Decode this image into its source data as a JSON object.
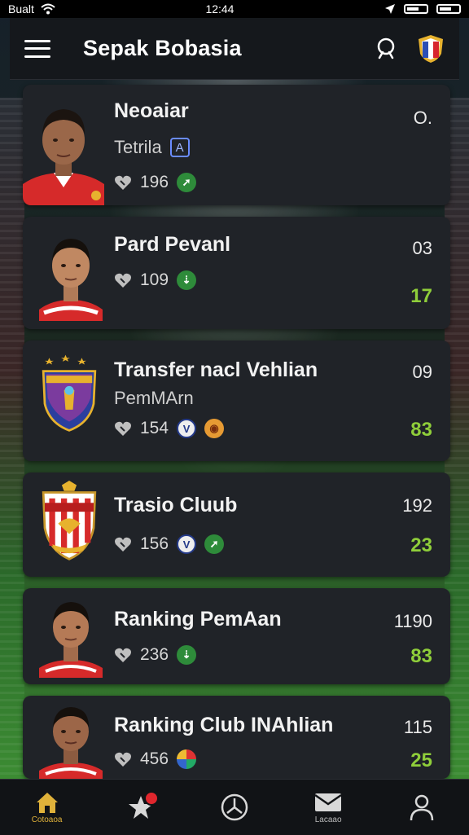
{
  "status": {
    "carrier": "Bualt",
    "time": "12:44"
  },
  "header": {
    "title": "Sepak Bobasia"
  },
  "cards": [
    {
      "title": "Neoaiar",
      "subtitle": "Tetrila",
      "sub_badge": "A",
      "count": "196",
      "right_top": "O.",
      "right_bottom": ""
    },
    {
      "title": "Pard Pevanl",
      "subtitle": "",
      "count": "109",
      "right_top": "03",
      "right_bottom": "17"
    },
    {
      "title": "Transfer nacl Vehlian",
      "subtitle": "PemMArn",
      "count": "154",
      "right_top": "09",
      "right_bottom": "83"
    },
    {
      "title": "Trasio Cluub",
      "subtitle": "",
      "count": "156",
      "right_top": "192",
      "right_bottom": "23"
    },
    {
      "title": "Ranking PemAan",
      "subtitle": "",
      "count": "236",
      "right_top": "1190",
      "right_bottom": "83"
    },
    {
      "title": "Ranking Club INAhlian",
      "subtitle": "",
      "count": "456",
      "right_top": "115",
      "right_bottom": "25"
    }
  ],
  "nav": [
    {
      "label": "Cotoaoa",
      "icon": "home-icon"
    },
    {
      "label": "",
      "icon": "star-icon"
    },
    {
      "label": "",
      "icon": "ball-icon"
    },
    {
      "label": "Lacaao",
      "icon": "inbox-icon"
    },
    {
      "label": "",
      "icon": "user-icon"
    }
  ],
  "colors": {
    "accent": "#e0b23a",
    "positive": "#8fce3a",
    "card": "#202328"
  }
}
